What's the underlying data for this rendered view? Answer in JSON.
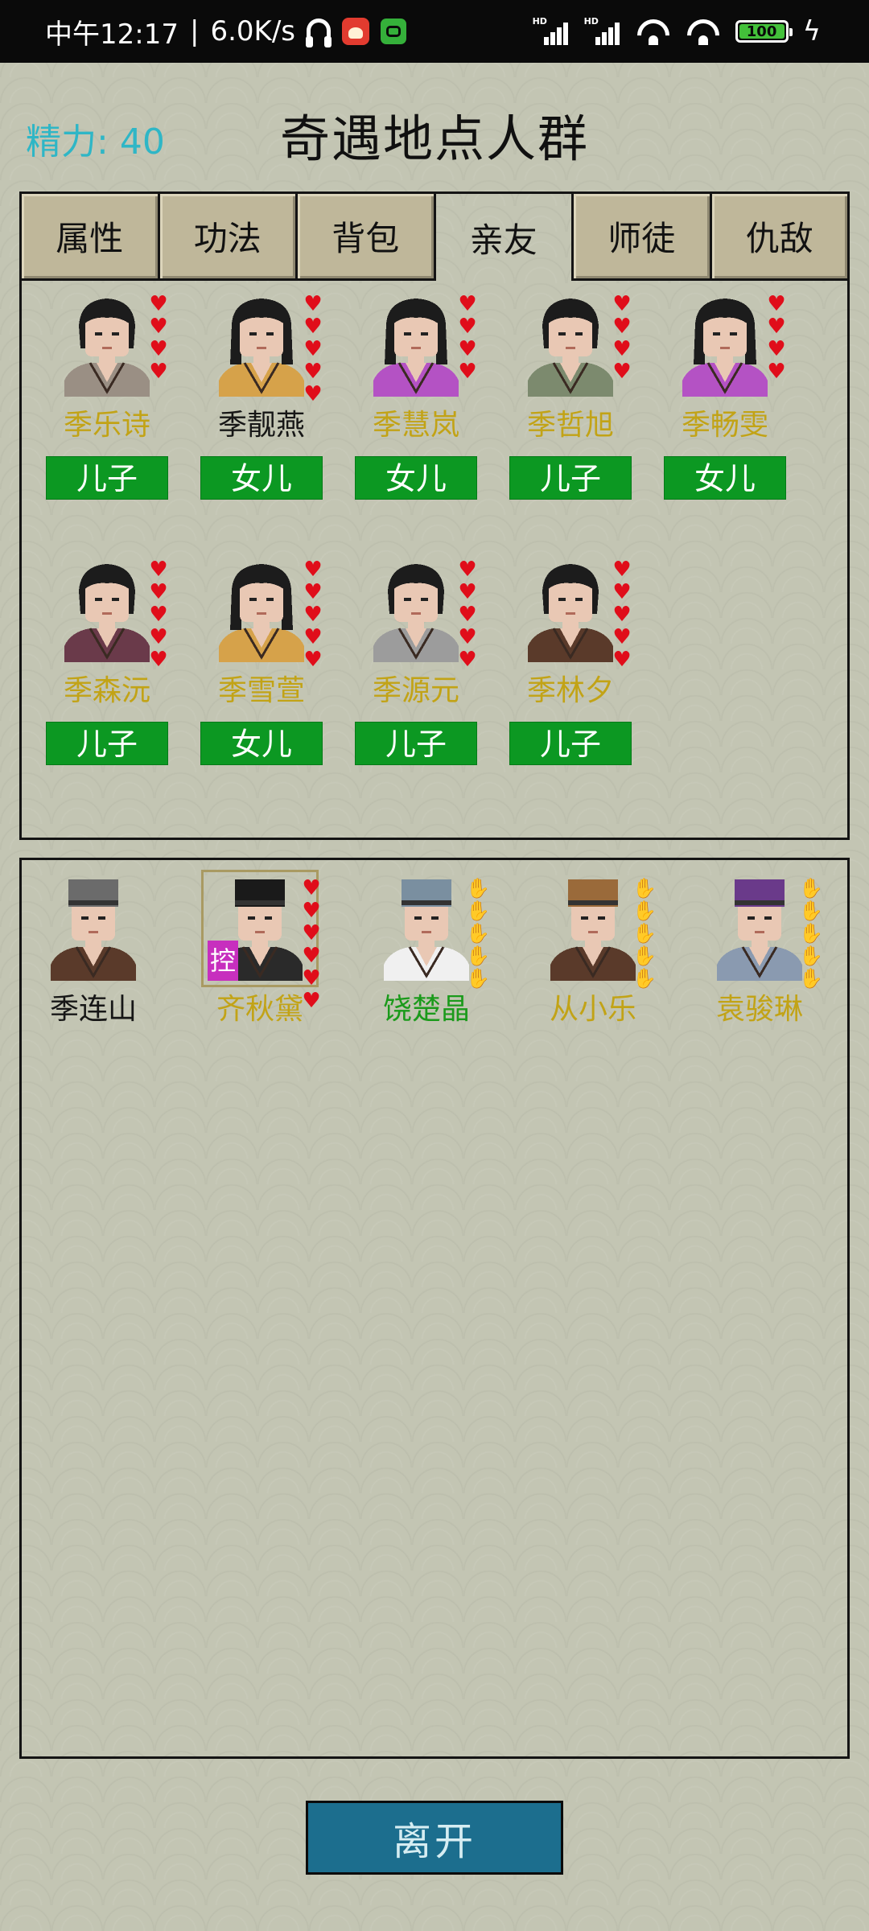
{
  "status_bar": {
    "time": "中午12:17",
    "speed": "6.0K/s",
    "battery": "100",
    "icons": [
      "headset-icon",
      "app-red-icon",
      "app-green-icon",
      "hd-signal-icon",
      "hd-signal-icon",
      "wifi-icon",
      "wifi-icon",
      "battery-icon",
      "charging-icon"
    ]
  },
  "header": {
    "energy_label": "精力:",
    "energy_value": "40",
    "title": "奇遇地点人群"
  },
  "tabs": [
    {
      "label": "属性",
      "active": false
    },
    {
      "label": "功法",
      "active": false
    },
    {
      "label": "背包",
      "active": false
    },
    {
      "label": "亲友",
      "active": true
    },
    {
      "label": "师徒",
      "active": false
    },
    {
      "label": "仇敌",
      "active": false
    }
  ],
  "relatives": [
    {
      "name": "季乐诗",
      "relation": "儿子",
      "name_color": "gold",
      "hearts": 4,
      "gender": "m",
      "robe": "#9a8f84"
    },
    {
      "name": "季靓燕",
      "relation": "女儿",
      "name_color": "black",
      "hearts": 5,
      "gender": "f",
      "robe": "#d6a24a"
    },
    {
      "name": "季慧岚",
      "relation": "女儿",
      "name_color": "gold",
      "hearts": 4,
      "gender": "f",
      "robe": "#b452c4"
    },
    {
      "name": "季哲旭",
      "relation": "儿子",
      "name_color": "gold",
      "hearts": 4,
      "gender": "m",
      "robe": "#7c8a6e"
    },
    {
      "name": "季畅雯",
      "relation": "女儿",
      "name_color": "gold",
      "hearts": 4,
      "gender": "f",
      "robe": "#b452c4"
    },
    {
      "name": "季森沅",
      "relation": "儿子",
      "name_color": "gold",
      "hearts": 5,
      "gender": "m",
      "robe": "#6a3a4a"
    },
    {
      "name": "季雪萱",
      "relation": "女儿",
      "name_color": "gold",
      "hearts": 5,
      "gender": "f",
      "robe": "#d6a24a"
    },
    {
      "name": "季源元",
      "relation": "儿子",
      "name_color": "gold",
      "hearts": 5,
      "gender": "m",
      "robe": "#9c9c9c"
    },
    {
      "name": "季林夕",
      "relation": "儿子",
      "name_color": "gold",
      "hearts": 5,
      "gender": "m",
      "robe": "#5a3a2a"
    }
  ],
  "crowd": [
    {
      "name": "季连山",
      "name_color": "black",
      "marks": 0,
      "mark_type": "none",
      "robe": "#5a3a2a",
      "hat": "#6b6b6b"
    },
    {
      "name": "齐秋黛",
      "name_color": "gold",
      "marks": 6,
      "mark_type": "heart",
      "robe": "#2a2a2a",
      "hat": "#1a1a1a",
      "badge": "控",
      "selected": true
    },
    {
      "name": "饶楚晶",
      "name_color": "green",
      "marks": 5,
      "mark_type": "paw",
      "robe": "#f0f0f0",
      "hat": "#7a8fa0"
    },
    {
      "name": "从小乐",
      "name_color": "gold",
      "marks": 5,
      "mark_type": "paw",
      "robe": "#5a3a2a",
      "hat": "#9a6a3a"
    },
    {
      "name": "袁骏琳",
      "name_color": "gold",
      "marks": 5,
      "mark_type": "paw",
      "robe": "#8a9ab0",
      "hat": "#6a3a8a"
    }
  ],
  "leave_button": "离开"
}
